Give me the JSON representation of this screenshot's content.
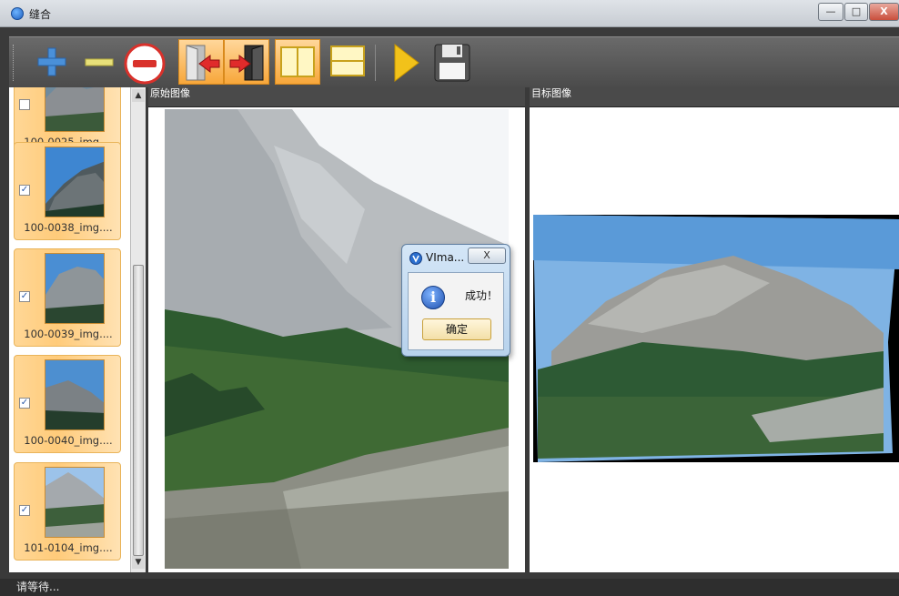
{
  "window": {
    "title": "缝合",
    "min_glyph": "—",
    "max_glyph": "□",
    "close_glyph": "X"
  },
  "toolbar": {
    "buttons": [
      {
        "name": "add-image",
        "icon": "plus-icon",
        "color": "#4a90d9"
      },
      {
        "name": "remove-image",
        "icon": "minus-icon",
        "color": "#e8e07a"
      },
      {
        "name": "clear-images",
        "icon": "no-entry-icon",
        "color": "#d9312b"
      },
      {
        "name": "stitch-left",
        "icon": "arrow-left-door-icon",
        "active": true
      },
      {
        "name": "stitch-right",
        "icon": "arrow-right-door-icon",
        "active": true
      },
      {
        "name": "layout-vertical",
        "icon": "two-columns-icon",
        "active": true
      },
      {
        "name": "layout-horizontal",
        "icon": "two-rows-icon"
      },
      {
        "name": "run",
        "icon": "play-icon",
        "color": "#f2c21a"
      },
      {
        "name": "save",
        "icon": "floppy-disk-icon",
        "color": "#555555"
      }
    ]
  },
  "sidebar": {
    "thumbnails": [
      {
        "caption": "100-0025_img....",
        "checked": false
      },
      {
        "caption": "100-0038_img....",
        "checked": true
      },
      {
        "caption": "100-0039_img....",
        "checked": true
      },
      {
        "caption": "100-0040_img....",
        "checked": true
      },
      {
        "caption": "101-0104_img....",
        "checked": true
      }
    ],
    "check_glyph": "✓",
    "scroll_up": "▲",
    "scroll_down": "▼"
  },
  "panes": {
    "source_header": "原始图像",
    "target_header": "目标图像"
  },
  "dialog": {
    "title": "VIma...",
    "close_glyph": "X",
    "icon_glyph": "i",
    "message": "成功！",
    "ok_label": "确定"
  },
  "status": {
    "text": "请等待..."
  }
}
